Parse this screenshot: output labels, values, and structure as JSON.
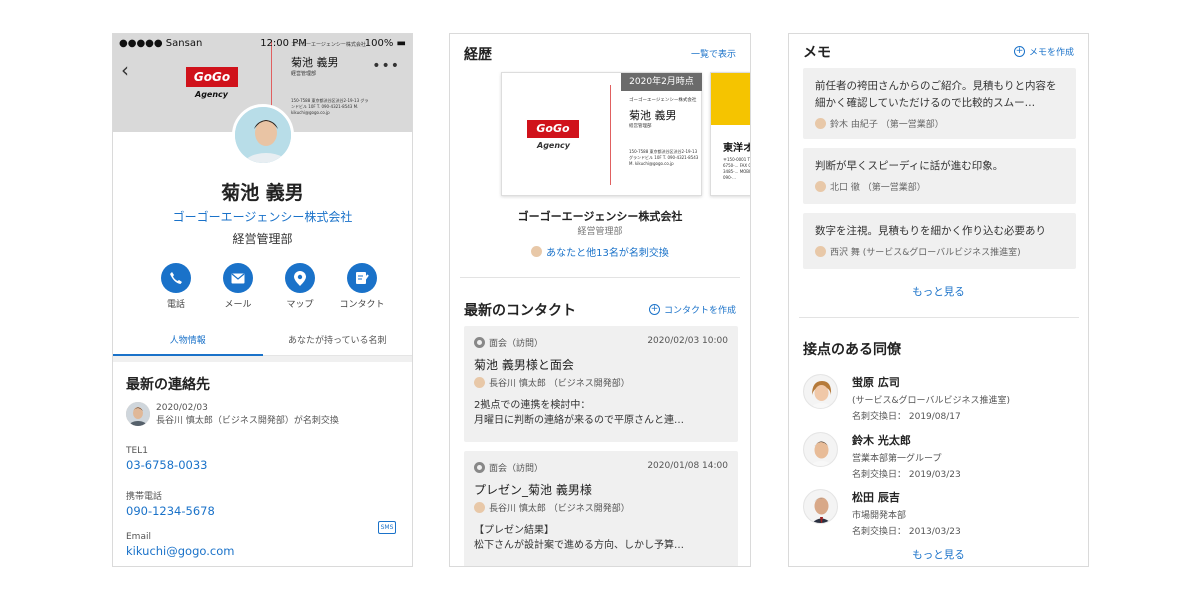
{
  "profile": {
    "status_carrier": "●●●●● Sansan",
    "status_time": "12:00 PM",
    "status_battery": "100%",
    "card_company": "ゴーゴーエージェンシー株式会社",
    "card_name": "菊池 義男",
    "card_dept": "経営管理部",
    "card_address": "150-7588 東京都渋谷区渋谷2-19-13 グランドビル 10F T. 090-4321-8543 M. kikuchi@gogo.co.jp",
    "logo_text": "GoGo",
    "logo_sub": "Agency",
    "name": "菊池 義男",
    "company": "ゴーゴーエージェンシー株式会社",
    "dept": "経営管理部",
    "actions": [
      "電話",
      "メール",
      "マップ",
      "コンタクト"
    ],
    "tabs": [
      "人物情報",
      "あなたが持っている名刺"
    ],
    "recent_title": "最新の連絡先",
    "recent_date": "2020/02/03",
    "recent_desc": "長谷川 慎太郎（ビジネス開発部）が名刺交換",
    "tel_label": "TEL1",
    "tel_value": "03-6758-0033",
    "mobile_label": "携帯電話",
    "mobile_value": "090-1234-5678",
    "sms_label": "SMS",
    "email_label": "Email",
    "email_value": "kikuchi@gogo.com",
    "accent": "#1a72c9"
  },
  "history": {
    "title": "経歴",
    "link": "一覧で表示",
    "badge": "2020年2月時点",
    "card2_title": "東洋オ",
    "card2_text": "〒150-0001 TEL 03-6750-... FAX 03-3485-... MOBILE 090-...",
    "company": "ゴーゴーエージェンシー株式会社",
    "dept": "経営管理部",
    "exchange": "あなたと他13名が名刺交換"
  },
  "contacts": {
    "title": "最新のコンタクト",
    "create": "コンタクトを作成",
    "items": [
      {
        "type": "面会（訪問）",
        "date": "2020/02/03 10:00",
        "title": "菊池 義男様と面会",
        "person": "長谷川 慎太郎 （ビジネス開発部）",
        "body1": "2拠点での連携を検討中：",
        "body2": "月曜日に判断の連絡が来るので平原さんと連…"
      },
      {
        "type": "面会（訪問）",
        "date": "2020/01/08 14:00",
        "title": "プレゼン_菊池 義男様",
        "person": "長谷川 慎太郎 （ビジネス開発部）",
        "body1": "【プレゼン結果】",
        "body2": "松下さんが設計案で進める方向、しかし予算…"
      }
    ]
  },
  "memo": {
    "title": "メモ",
    "create": "メモを作成",
    "items": [
      {
        "text": "前任者の袴田さんからのご紹介。見積もりと内容を細かく確認していただけるので比較的スムー…",
        "who": "鈴木 由紀子 （第一営業部）"
      },
      {
        "text": "判断が早くスピーディに話が進む印象。",
        "who": "北口 徹 （第一営業部）"
      },
      {
        "text": "数字を注視。見積もりを細かく作り込む必要あり",
        "who": "西沢 舞 (サービス&グローバルビジネス推進室)"
      }
    ],
    "more": "もっと見る"
  },
  "colleagues": {
    "title": "接点のある同僚",
    "items": [
      {
        "name": "蛍原 広司",
        "dept": "(サービス&グローバルビジネス推進室)",
        "date": "名刺交換日： 2019/08/17"
      },
      {
        "name": "鈴木 光太郎",
        "dept": "営業本部第一グループ",
        "date": "名刺交換日： 2019/03/23"
      },
      {
        "name": "松田 辰吉",
        "dept": "市場開発本部",
        "date": "名刺交換日： 2013/03/23"
      }
    ],
    "more": "もっと見る"
  }
}
